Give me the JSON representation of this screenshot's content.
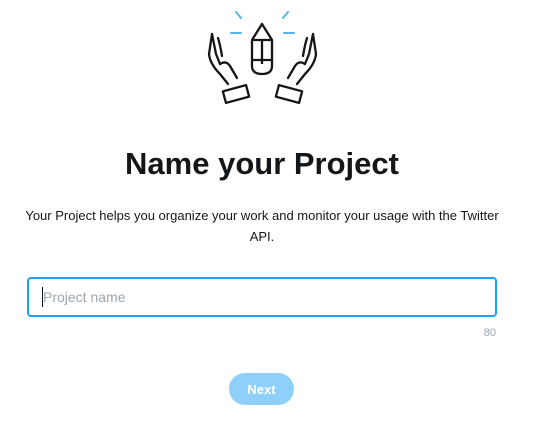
{
  "illustration": {
    "icon": "hands-holding-pencil-icon",
    "accent_color": "#55b4ea"
  },
  "header": {
    "title": "Name your Project"
  },
  "main": {
    "description": "Your Project helps you organize your work and monitor your usage with the Twitter API.",
    "project_name": {
      "value": "",
      "placeholder": "Project name",
      "max_chars": "80"
    },
    "next_label": "Next"
  },
  "colors": {
    "input_border": "#1da1f2",
    "button_disabled": "#8ed0f9",
    "muted_text": "#9aa6b0"
  }
}
